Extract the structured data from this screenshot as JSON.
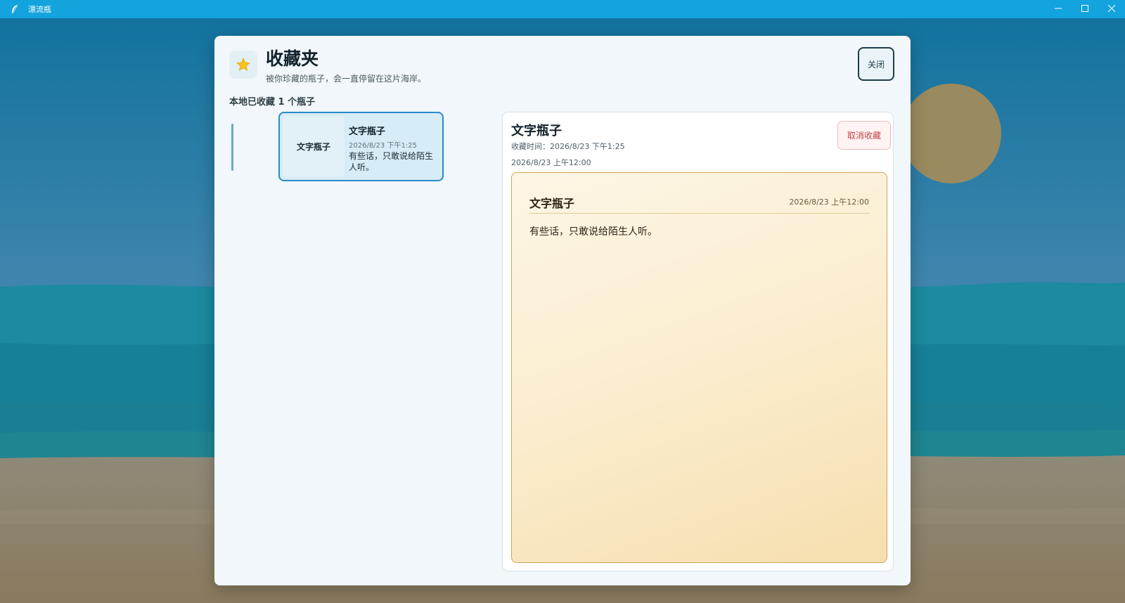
{
  "window": {
    "title": "漂流瓶",
    "icon": "feather-icon",
    "controls": [
      "minimize-icon",
      "maximize-icon",
      "close-icon"
    ]
  },
  "favorites": {
    "icon": "star-icon",
    "title": "收藏夹",
    "subtitle": "被你珍藏的瓶子，会一直停留在这片海岸。",
    "close_label": "关闭",
    "count_label": "本地已收藏 1 个瓶子",
    "items": [
      {
        "thumb_label": "文字瓶子",
        "title": "文字瓶子",
        "time": "2026/8/23 下午1:25",
        "excerpt": "有些话，只敢说给陌生人听。"
      }
    ]
  },
  "detail": {
    "title": "文字瓶子",
    "favorited_time": "收藏时间：2026/8/23 下午1:25",
    "date": "2026/8/23 上午12:00",
    "unfavorite_label": "取消收藏",
    "letter": {
      "title": "文字瓶子",
      "date": "2026/8/23 上午12:00",
      "body": "有些话，只敢说给陌生人听。"
    }
  },
  "colors": {
    "titlebar": "#13a3dd",
    "accent": "#2a8cc6",
    "danger": "#c44242",
    "paper": "#fbeed1"
  }
}
